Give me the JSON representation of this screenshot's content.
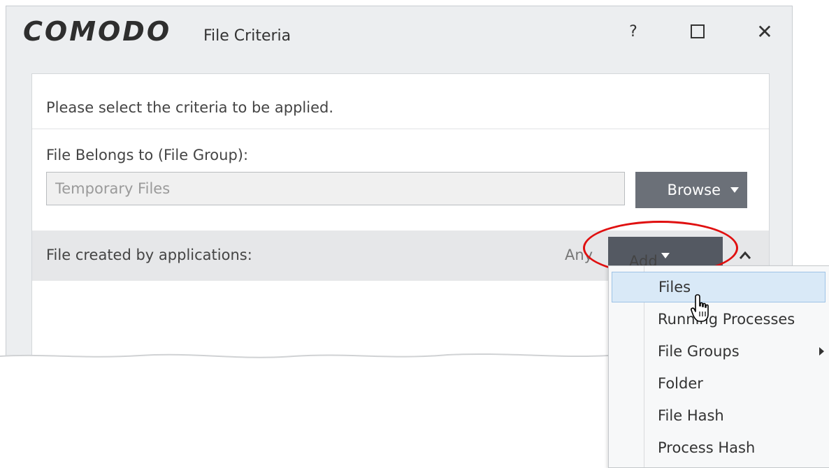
{
  "window": {
    "logo": "COMODO",
    "title": "File Criteria",
    "help_label": "?",
    "close_label": "✕"
  },
  "instruction": "Please select the criteria to be applied.",
  "file_group": {
    "label": "File Belongs to (File Group):",
    "value": "Temporary Files",
    "browse_label": "Browse"
  },
  "applications": {
    "label": "File created by applications:",
    "any_label": "Any",
    "add_label": "Add"
  },
  "add_menu": {
    "items": [
      {
        "label": "Files"
      },
      {
        "label": "Running Processes"
      },
      {
        "label": "File Groups"
      },
      {
        "label": "Folder"
      },
      {
        "label": "File Hash"
      },
      {
        "label": "Process Hash"
      }
    ]
  },
  "colors": {
    "accent_dark": "#545962",
    "button_gray": "#6b7078",
    "highlight": "#d9e9f7",
    "annotation_red": "#e01010"
  },
  "icons": {
    "help": "question-mark-icon",
    "maximize": "maximize-icon",
    "close": "close-icon",
    "dropdown": "caret-down-icon",
    "collapse": "chevron-up-icon",
    "submenu": "submenu-arrow-icon",
    "cursor": "hand-pointer-icon"
  }
}
